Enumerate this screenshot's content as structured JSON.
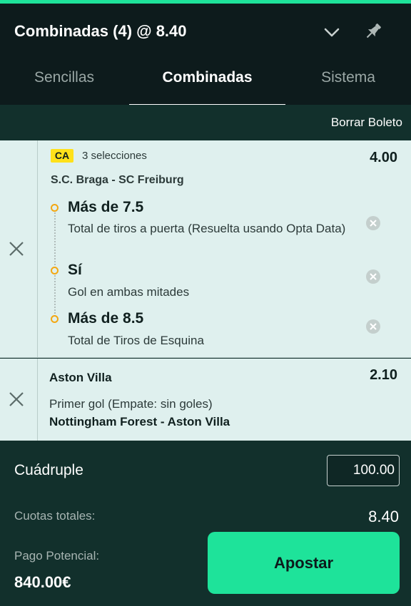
{
  "header": {
    "title": "Combinadas (4) @ 8.40",
    "icons": [
      "chevron-down-icon",
      "pin-icon"
    ]
  },
  "tabs": [
    {
      "label": "Sencillas",
      "active": false
    },
    {
      "label": "Combinadas",
      "active": true
    },
    {
      "label": "Sistema",
      "active": false
    }
  ],
  "clear_label": "Borrar Boleto",
  "bets": [
    {
      "badge": "CA",
      "selections_label": "3 selecciones",
      "odds": "4.00",
      "match": "S.C. Braga - SC Freiburg",
      "legs": [
        {
          "title": "Más de 7.5",
          "market": "Total de tiros a puerta (Resuelta usando Opta Data)"
        },
        {
          "title": "Sí",
          "market": "Gol en ambas mitades"
        },
        {
          "title": "Más de 8.5",
          "market": "Total de Tiros de Esquina"
        }
      ]
    },
    {
      "team": "Aston Villa",
      "odds": "2.10",
      "market": "Primer gol (Empate: sin goles)",
      "match": "Nottingham Forest - Aston Villa"
    }
  ],
  "footer": {
    "bet_type": "Cuádruple",
    "stake": "100.00",
    "total_odds_label": "Cuotas totales:",
    "total_odds": "8.40",
    "payout_label": "Pago Potencial:",
    "payout": "840.00€",
    "bet_button": "Apostar"
  },
  "colors": {
    "accent": "#1ee39a",
    "header_bg": "#0d1b1c",
    "panel_bg": "#12302c",
    "card_bg": "#dff0ee",
    "badge": "#ffe11a",
    "leg_dot": "#f3a712"
  }
}
